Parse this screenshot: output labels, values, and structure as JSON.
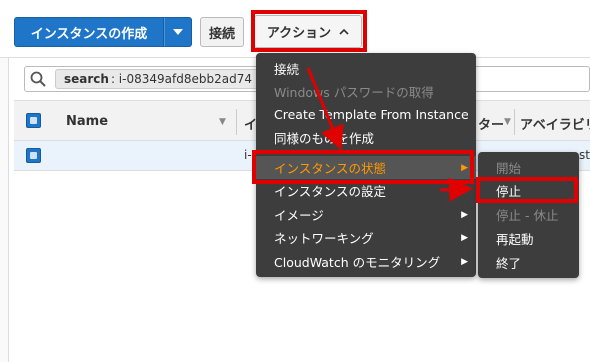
{
  "toolbar": {
    "create_instance_label": "インスタンスの作成",
    "caret_icon": "chevron-down-icon",
    "connect_label": "接続",
    "actions_label": "アクション",
    "actions_caret": "^"
  },
  "search": {
    "key": "search",
    "value": ": i-08349afd8ebb2ad74"
  },
  "table": {
    "header_name": "Name",
    "header_partial_left": "イ",
    "header_partial_mid": "ター",
    "header_az": "アベイラビリ",
    "row_partial_left": "i-",
    "row_partial_right": "st"
  },
  "actions_menu": {
    "items": [
      {
        "label": "接続",
        "state": "normal",
        "submenu": false
      },
      {
        "label": "Windows パスワードの取得",
        "state": "disabled",
        "submenu": false
      },
      {
        "label": "Create Template From Instance",
        "state": "normal",
        "submenu": false
      },
      {
        "label": "同様のものを作成",
        "state": "normal",
        "submenu": false
      },
      {
        "label": "インスタンスの状態",
        "state": "highlight",
        "submenu": true
      },
      {
        "label": "インスタンスの設定",
        "state": "normal",
        "submenu": true
      },
      {
        "label": "イメージ",
        "state": "normal",
        "submenu": true
      },
      {
        "label": "ネットワーキング",
        "state": "normal",
        "submenu": true
      },
      {
        "label": "CloudWatch のモニタリング",
        "state": "normal",
        "submenu": true
      }
    ]
  },
  "state_submenu": {
    "items": [
      {
        "label": "開始",
        "state": "disabled"
      },
      {
        "label": "停止",
        "state": "normal"
      },
      {
        "label": "停止 - 休止",
        "state": "disabled"
      },
      {
        "label": "再起動",
        "state": "normal"
      },
      {
        "label": "終了",
        "state": "normal"
      }
    ]
  },
  "colors": {
    "primary": "#1f76c9",
    "highlight_text": "#ff9900",
    "annotation_red": "#e00000",
    "menu_bg": "#3d3d3d"
  }
}
